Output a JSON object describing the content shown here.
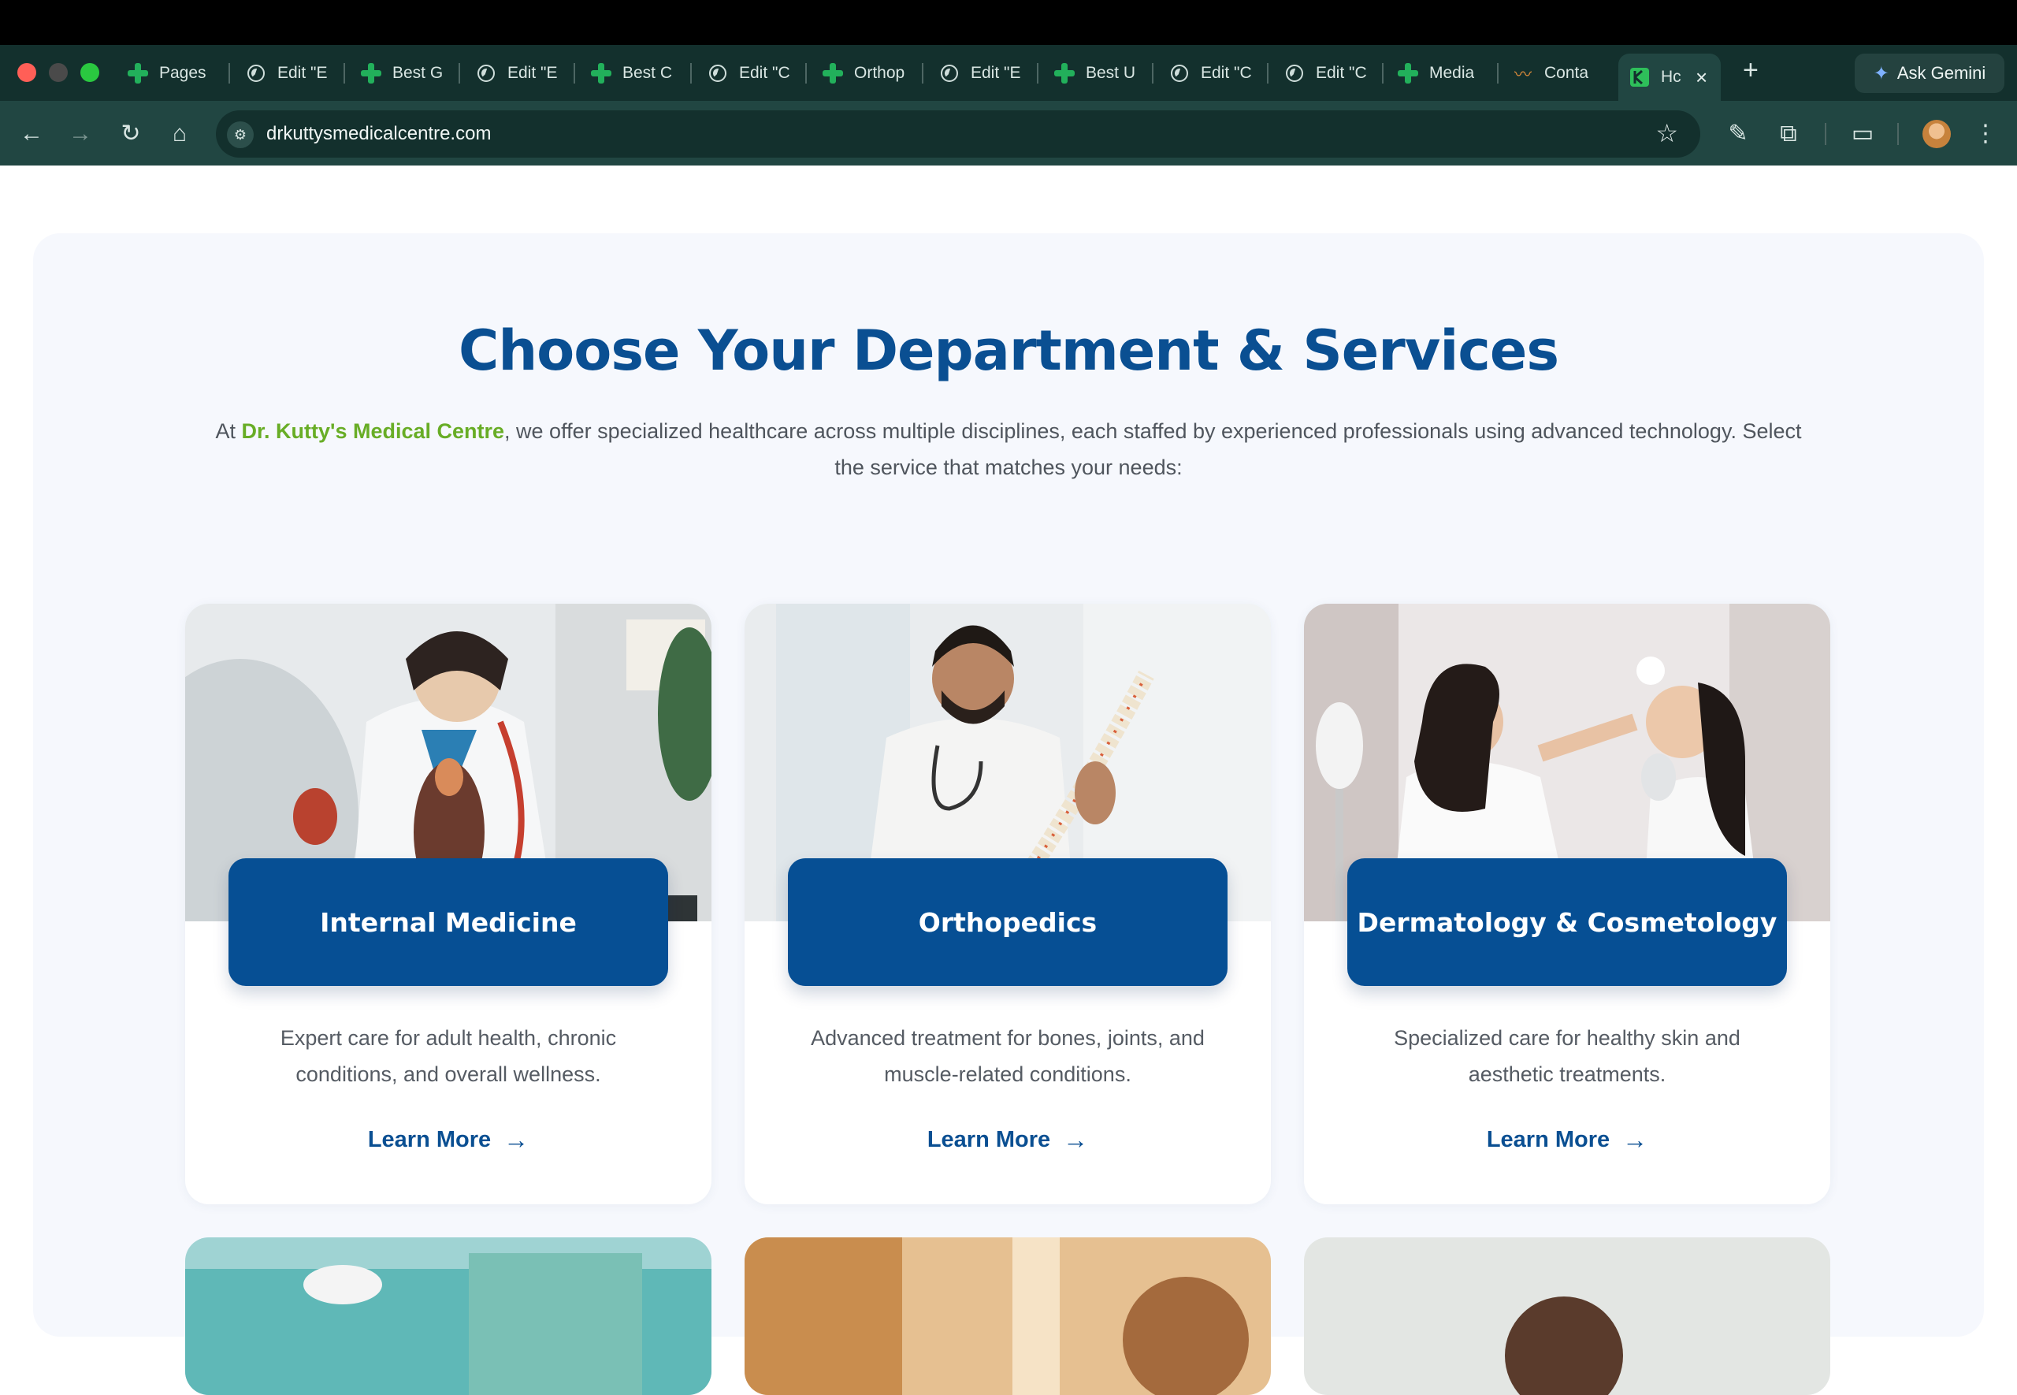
{
  "browser": {
    "tabs": [
      {
        "label": "Pages",
        "icon": "medical-cross-icon"
      },
      {
        "label": "Edit \"E",
        "icon": "globe-icon"
      },
      {
        "label": "Best G",
        "icon": "medical-cross-icon"
      },
      {
        "label": "Edit \"E",
        "icon": "globe-icon"
      },
      {
        "label": "Best C",
        "icon": "medical-cross-icon"
      },
      {
        "label": "Edit \"C",
        "icon": "globe-icon"
      },
      {
        "label": "Orthop",
        "icon": "medical-cross-icon"
      },
      {
        "label": "Edit \"E",
        "icon": "globe-icon"
      },
      {
        "label": "Best U",
        "icon": "medical-cross-icon"
      },
      {
        "label": "Edit \"C",
        "icon": "globe-icon"
      },
      {
        "label": "Edit \"C",
        "icon": "globe-icon"
      },
      {
        "label": "Media",
        "icon": "medical-cross-icon"
      },
      {
        "label": "Conta",
        "icon": "wave-logo-icon"
      },
      {
        "label": "Hc",
        "icon": "k-logo-icon"
      }
    ],
    "gemini_label": "Ask Gemini",
    "url": "drkuttysmedicalcentre.com",
    "colors": {
      "frame": "#13302d",
      "toolbar": "#214642",
      "accent_green": "#22b05b"
    }
  },
  "page": {
    "heading": "Choose Your Department & Services",
    "intro_prefix": "At ",
    "intro_brand": "Dr. Kutty's Medical Centre",
    "intro_rest": ", we offer specialized healthcare across multiple disciplines, each staffed by experienced professionals using advanced technology. Select the service that matches your needs:",
    "colors": {
      "heading": "#0a4f92",
      "brand": "#68ad26",
      "badge": "#064f94",
      "section_bg": "#f6f8fd"
    }
  },
  "cards": [
    {
      "title": "Internal Medicine",
      "description": "Expert care for adult health, chronic conditions, and overall wellness.",
      "link": "Learn More"
    },
    {
      "title": "Orthopedics",
      "description": "Advanced treatment for bones, joints, and muscle-related conditions.",
      "link": "Learn More"
    },
    {
      "title": "Dermatology & Cosmetology",
      "description": "Specialized care for healthy skin and aesthetic treatments.",
      "link": "Learn More"
    }
  ]
}
